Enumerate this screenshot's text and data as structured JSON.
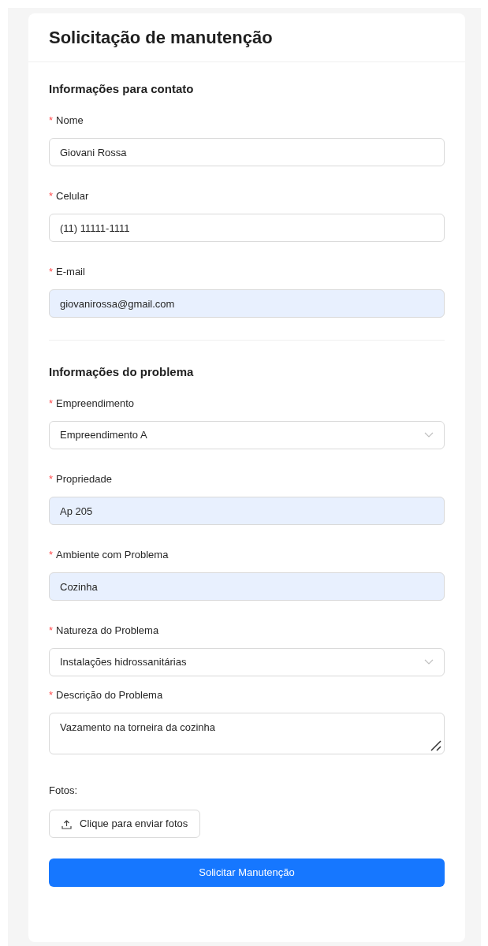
{
  "title": "Solicitação de manutenção",
  "sections": [
    {
      "heading": "Informações para contato",
      "fields": [
        {
          "kind": "input",
          "label": "Nome",
          "marker": "*",
          "value": "Giovani Rossa",
          "autofilled": false
        },
        {
          "kind": "input",
          "label": "Celular",
          "marker": "*",
          "value": "(11) 11111-1111",
          "autofilled": false
        },
        {
          "kind": "input",
          "label": "E-mail",
          "marker": "*",
          "value": "giovanirossa@gmail.com",
          "autofilled": true
        }
      ]
    },
    {
      "heading": "Informações do problema",
      "fields": [
        {
          "kind": "select",
          "label": "Empreendimento",
          "marker": "*",
          "value": "Empreendimento A",
          "autofilled": false
        },
        {
          "kind": "input",
          "label": "Propriedade",
          "marker": "*",
          "value": "Ap 205",
          "autofilled": true
        },
        {
          "kind": "input",
          "label": "Ambiente com Problema",
          "marker": "*",
          "value": "Cozinha",
          "autofilled": true
        },
        {
          "kind": "select",
          "label": "Natureza do Problema",
          "marker": "*",
          "value": "Instalações hidrossanitárias",
          "autofilled": false
        },
        {
          "kind": "textarea",
          "label": "Descrição do Problema",
          "marker": "*",
          "value": "Vazamento na torneira da cozinha",
          "autofilled": false
        }
      ]
    }
  ],
  "photos": {
    "label": "Fotos:",
    "button": "Clique para enviar fotos"
  },
  "submit": "Solicitar Manutenção"
}
